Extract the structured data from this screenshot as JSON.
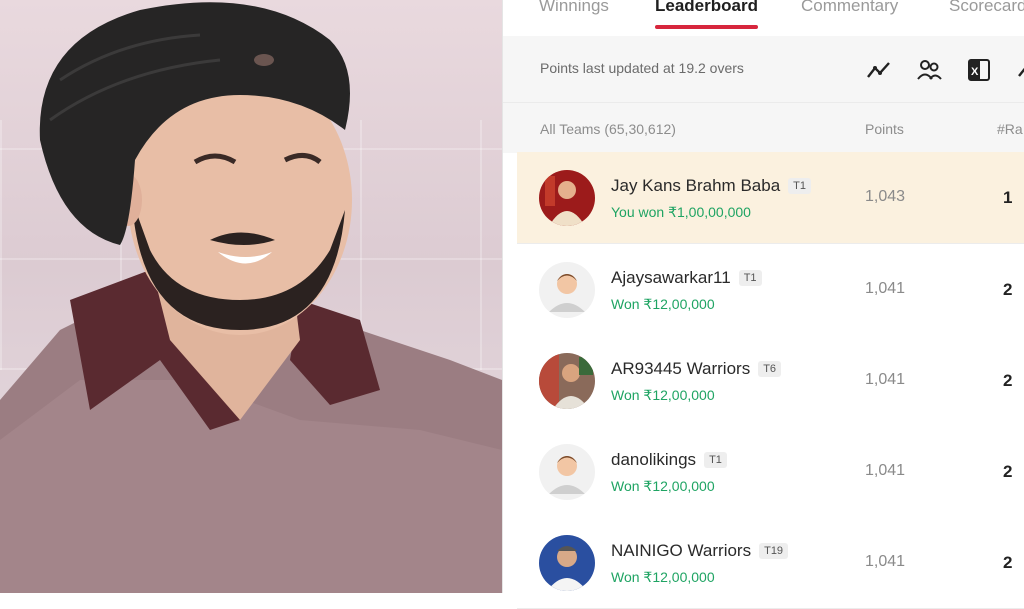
{
  "tabs": [
    "Winnings",
    "Leaderboard",
    "Commentary",
    "Scorecard"
  ],
  "info": {
    "points_updated": "Points last updated at 19.2 overs",
    "tool_icons": [
      "trend-chart-icon",
      "compare-users-icon",
      "excel-download-icon",
      "more-tool-icon"
    ]
  },
  "header": {
    "teams": "All Teams (65,30,612)",
    "points": "Points",
    "rank": "#Ra"
  },
  "rows": [
    {
      "name": "Jay Kans Brahm Baba",
      "team": "T1",
      "won": "You won ₹1,00,00,000",
      "points": "1,043",
      "rank": "1",
      "highlight": true,
      "avatar": "photo-red"
    },
    {
      "name": "Ajaysawarkar11",
      "team": "T1",
      "won": "Won ₹12,00,000",
      "points": "1,041",
      "rank": "2",
      "highlight": false,
      "avatar": "default"
    },
    {
      "name": "AR93445 Warriors",
      "team": "T6",
      "won": "Won ₹12,00,000",
      "points": "1,041",
      "rank": "2",
      "highlight": false,
      "avatar": "photo-group"
    },
    {
      "name": "danolikings",
      "team": "T1",
      "won": "Won ₹12,00,000",
      "points": "1,041",
      "rank": "2",
      "highlight": false,
      "avatar": "default"
    },
    {
      "name": "NAINIGO Warriors",
      "team": "T19",
      "won": "Won ₹12,00,000",
      "points": "1,041",
      "rank": "2",
      "highlight": false,
      "avatar": "photo-blue"
    }
  ],
  "colors": {
    "accent": "#d7263d",
    "won": "#1fa463",
    "highlight_row": "#fbf1df"
  }
}
